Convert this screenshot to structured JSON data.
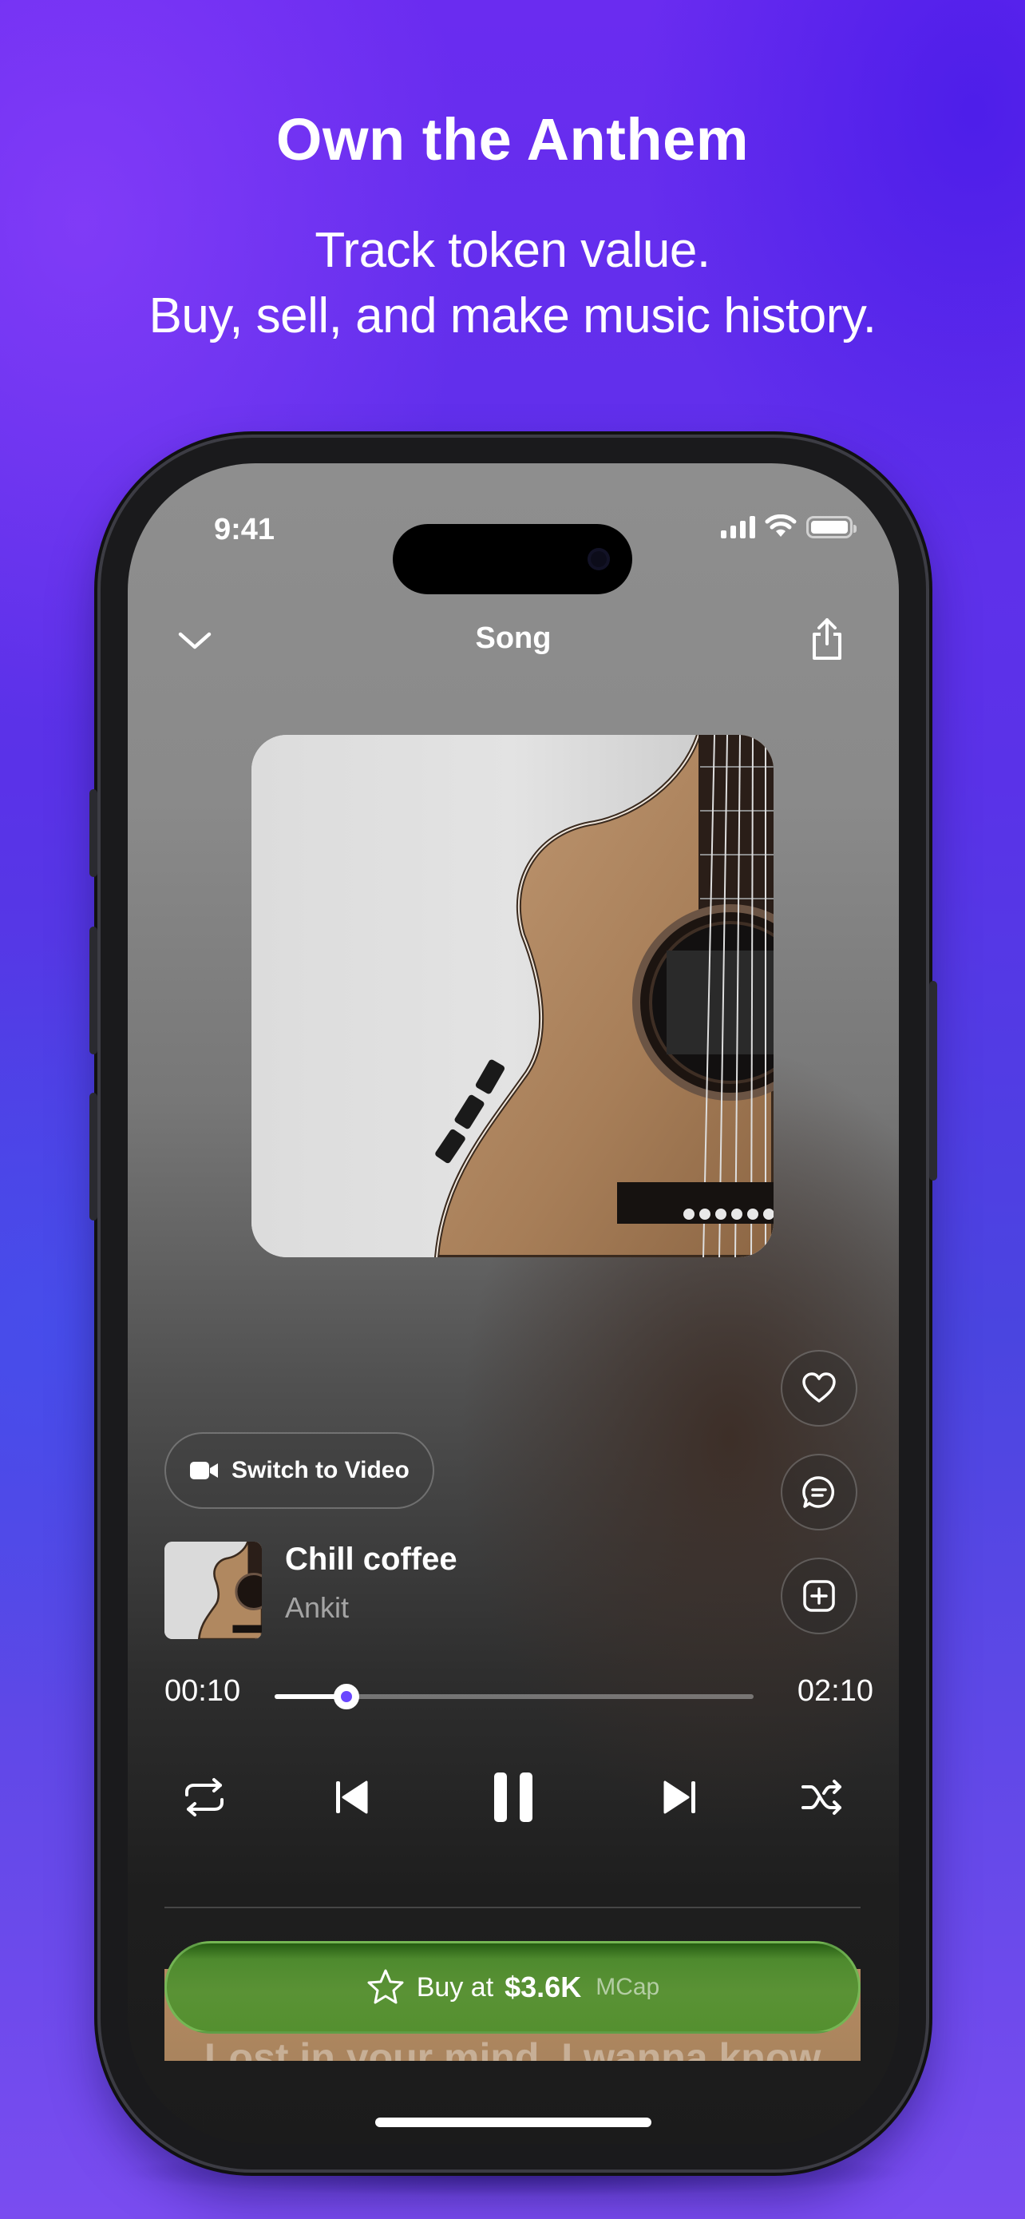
{
  "promo": {
    "headline": "Own the Anthem",
    "subline_1": "Track token value.",
    "subline_2": "Buy, sell, and make music history."
  },
  "status_bar": {
    "time": "9:41"
  },
  "header": {
    "title": "Song"
  },
  "player": {
    "switch_label": "Switch to Video",
    "song_title": "Chill coffee",
    "artist": "Ankit",
    "current_time": "00:10",
    "total_time": "02:10",
    "progress": 0.15,
    "state": "playing"
  },
  "lyrics": {
    "current_line": "Lost in your mind, I wanna know"
  },
  "buy": {
    "label": "Buy at",
    "value": "$3.6K",
    "unit": "MCap"
  },
  "colors": {
    "accent": "#6a47ff",
    "buy_green": "#5a9235",
    "background_purple": "#5a32e8"
  },
  "icons": [
    "chevron-down-icon",
    "share-icon",
    "heart-icon",
    "comment-icon",
    "add-icon",
    "video-camera-icon",
    "repeat-icon",
    "previous-icon",
    "pause-icon",
    "next-icon",
    "shuffle-icon",
    "star-icon"
  ]
}
